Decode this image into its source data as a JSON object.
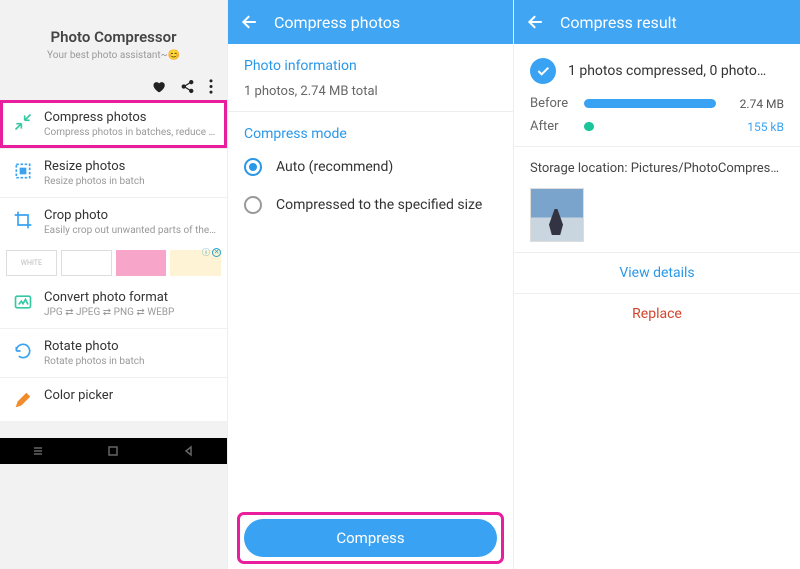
{
  "pane1": {
    "app_title": "Photo Compressor",
    "app_subtitle": "Your best photo assistant~😊",
    "items": [
      {
        "title": "Compress photos",
        "desc": "Compress photos in batches, reduce p…",
        "highlight": true
      },
      {
        "title": "Resize photos",
        "desc": "Resize photos in batch"
      },
      {
        "title": "Crop photo",
        "desc": "Easily crop out unwanted parts of the…"
      },
      {
        "title": "Convert photo format",
        "desc": "JPG ⇄ JPEG ⇄ PNG ⇄ WEBP"
      },
      {
        "title": "Rotate photo",
        "desc": "Rotate photos in batch"
      },
      {
        "title": "Color picker",
        "desc": ""
      }
    ],
    "ad_text": "WHITE"
  },
  "pane2": {
    "header": "Compress photos",
    "section_info_title": "Photo information",
    "info_line": "1 photos, 2.74 MB total",
    "section_mode_title": "Compress mode",
    "modes": [
      {
        "label": "Auto (recommend)",
        "checked": true
      },
      {
        "label": "Compressed to the specified size",
        "checked": false
      }
    ],
    "compress_button": "Compress"
  },
  "pane3": {
    "header": "Compress result",
    "result_line": "1 photos compressed, 0 photo…",
    "before_label": "Before",
    "before_value": "2.74 MB",
    "after_label": "After",
    "after_value": "155 kB",
    "storage_line": "Storage location: Pictures/PhotoCompres…",
    "view_details": "View details",
    "replace": "Replace"
  }
}
